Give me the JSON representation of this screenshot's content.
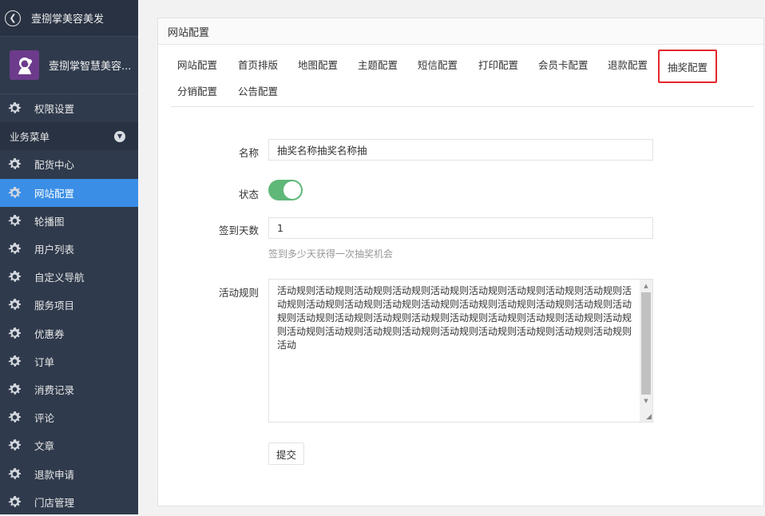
{
  "sidebar": {
    "header_title": "壹捌掌美容美发",
    "profile_name": "壹捌掌智慧美容...",
    "permission_item": "权限设置",
    "group_label": "业务菜单",
    "items": [
      {
        "label": "配货中心",
        "active": false
      },
      {
        "label": "网站配置",
        "active": true
      },
      {
        "label": "轮播图",
        "active": false
      },
      {
        "label": "用户列表",
        "active": false
      },
      {
        "label": "自定义导航",
        "active": false
      },
      {
        "label": "服务项目",
        "active": false
      },
      {
        "label": "优惠券",
        "active": false
      },
      {
        "label": "订单",
        "active": false
      },
      {
        "label": "消费记录",
        "active": false
      },
      {
        "label": "评论",
        "active": false
      },
      {
        "label": "文章",
        "active": false
      },
      {
        "label": "退款申请",
        "active": false
      },
      {
        "label": "门店管理",
        "active": false
      }
    ]
  },
  "panel": {
    "title": "网站配置",
    "tabs": [
      "网站配置",
      "首页排版",
      "地图配置",
      "主题配置",
      "短信配置",
      "打印配置",
      "会员卡配置",
      "退款配置",
      "抽奖配置",
      "分销配置",
      "公告配置"
    ],
    "selected_tab": "抽奖配置"
  },
  "form": {
    "name_label": "名称",
    "name_value": "抽奖名称抽奖名称抽",
    "status_label": "状态",
    "status_on": true,
    "days_label": "签到天数",
    "days_value": "1",
    "days_hint": "签到多少天获得一次抽奖机会",
    "rules_label": "活动规则",
    "rules_value": "活动规则活动规则活动规则活动规则活动规则活动规则活动规则活动规则活动规则活动规则活动规则活动规则活动规则活动规则活动规则活动规则活动规则活动规则活动规则活动规则活动规则活动规则活动规则活动规则活动规则活动规则活动规则活动规则活动规则活动规则活动规则活动规则活动规则活动规则活动规则活动规则活动规则活动",
    "submit_label": "提交"
  },
  "colors": {
    "sidebar_bg": "#2f3a4c",
    "active_bg": "#3a8ee6",
    "toggle_on": "#5fb878",
    "highlight_border": "#e4262d"
  }
}
